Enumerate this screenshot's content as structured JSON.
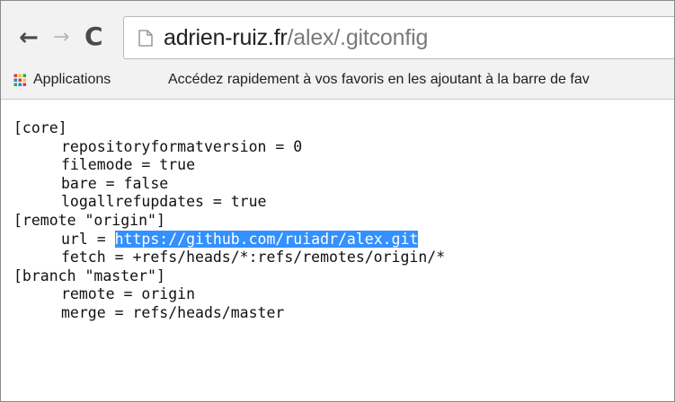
{
  "browser": {
    "url_host": "adrien-ruiz.fr",
    "url_path": "/alex/.gitconfig",
    "back_glyph": "←",
    "forward_glyph": "→",
    "reload_glyph": "C"
  },
  "bookmarks": {
    "apps_label": "Applications",
    "hint": "Accédez rapidement à vos favoris en les ajoutant à la barre de fav",
    "apps_icon_colors": [
      "#e53935",
      "#fbc02d",
      "#43a047",
      "#1e88e5",
      "#e53935",
      "#fbc02d",
      "#43a047",
      "#1e88e5",
      "#e53935"
    ]
  },
  "file": {
    "lines": [
      {
        "text": "[core]",
        "indent": false
      },
      {
        "text": "repositoryformatversion = 0",
        "indent": true
      },
      {
        "text": "filemode = true",
        "indent": true
      },
      {
        "text": "bare = false",
        "indent": true
      },
      {
        "text": "logallrefupdates = true",
        "indent": true
      },
      {
        "text": "[remote \"origin\"]",
        "indent": false
      },
      {
        "text": "url = ",
        "indent": true,
        "selected": "https://github.com/ruiadr/alex.git"
      },
      {
        "text": "fetch = +refs/heads/*:refs/remotes/origin/*",
        "indent": true
      },
      {
        "text": "[branch \"master\"]",
        "indent": false
      },
      {
        "text": "remote = origin",
        "indent": true
      },
      {
        "text": "merge = refs/heads/master",
        "indent": true
      }
    ]
  },
  "colors": {
    "selection": "#3390ff",
    "toolbar": "#f2f2f2"
  }
}
